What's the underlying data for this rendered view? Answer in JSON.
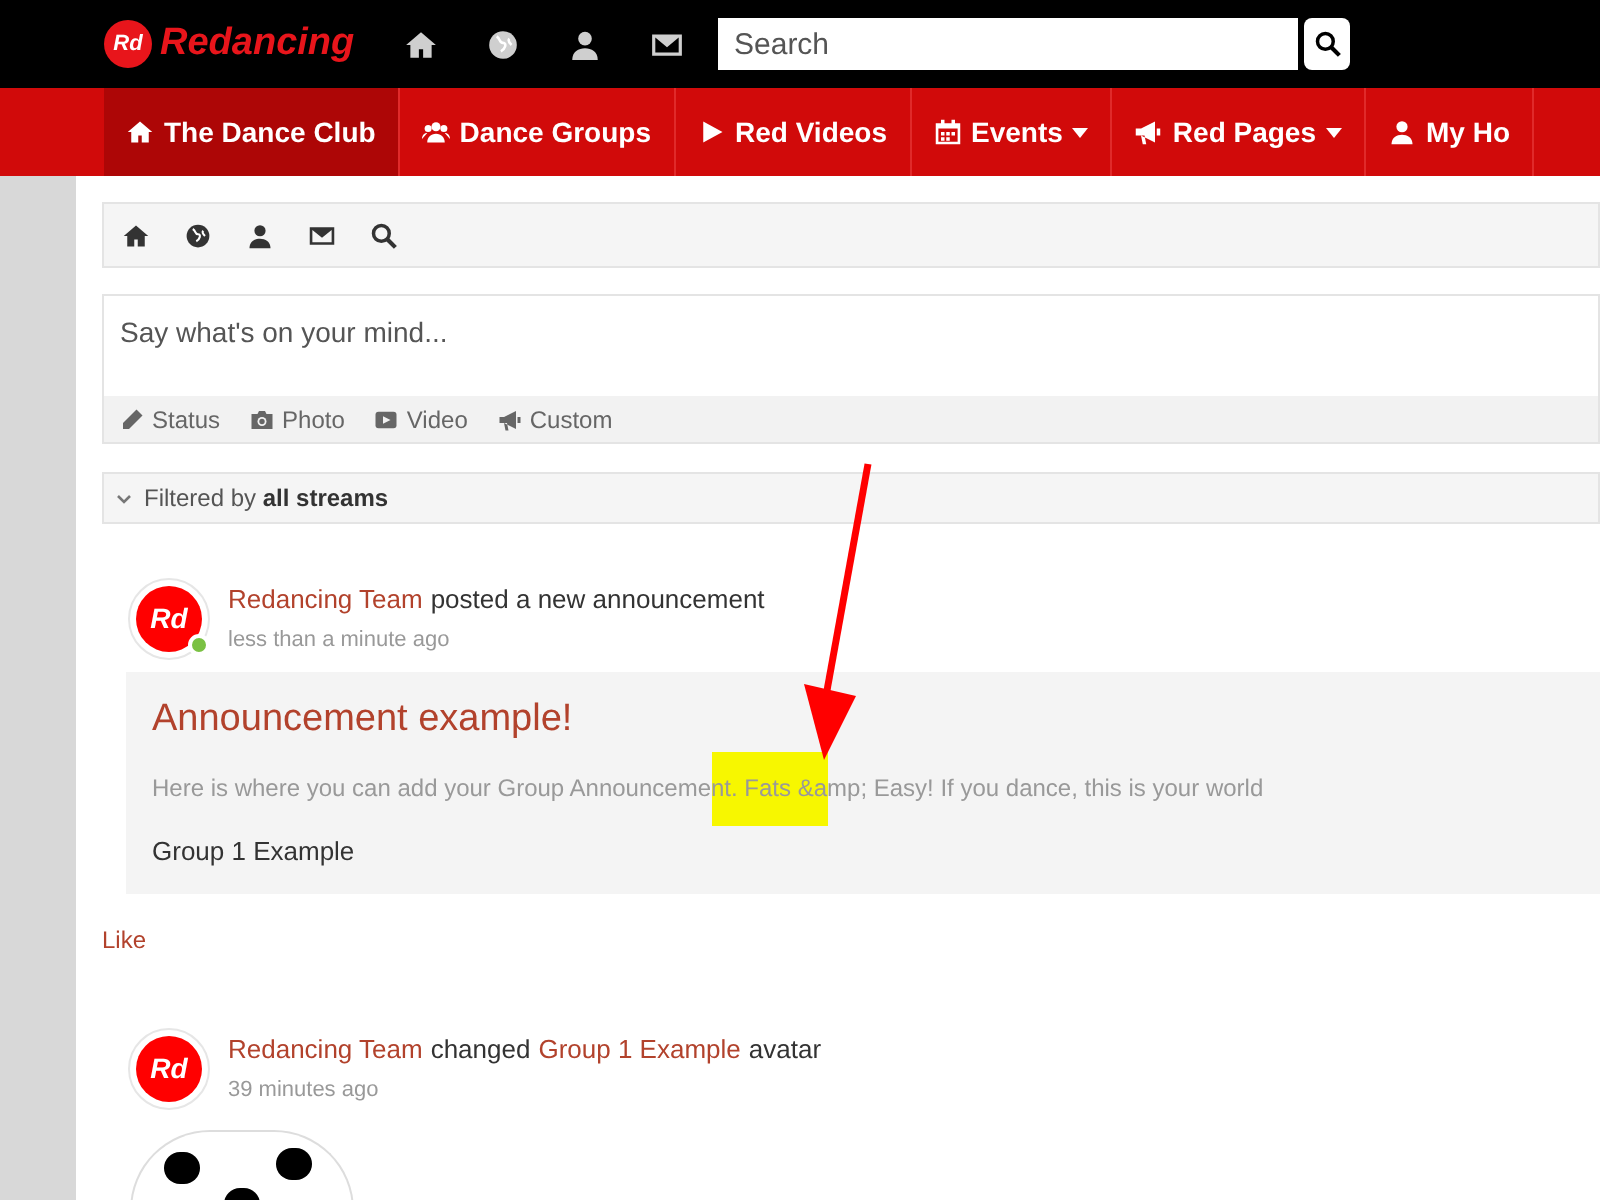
{
  "header": {
    "logo_badge": "Rd",
    "logo": "Redancing",
    "search": {
      "placeholder": "Search"
    }
  },
  "nav": [
    {
      "label": "The Dance Club",
      "selected": true,
      "dropdown": false
    },
    {
      "label": "Dance Groups",
      "selected": false,
      "dropdown": false
    },
    {
      "label": "Red Videos",
      "selected": false,
      "dropdown": false
    },
    {
      "label": "Events",
      "selected": false,
      "dropdown": true
    },
    {
      "label": "Red Pages",
      "selected": false,
      "dropdown": true
    },
    {
      "label": "My Ho",
      "selected": false,
      "dropdown": false
    }
  ],
  "composer": {
    "placeholder": "Say what's on your mind...",
    "actions": [
      {
        "label": "Status"
      },
      {
        "label": "Photo"
      },
      {
        "label": "Video"
      },
      {
        "label": "Custom"
      }
    ]
  },
  "filter": {
    "text": "Filtered by **all streams**"
  },
  "posts": [
    {
      "avatar": "Rd",
      "online": true,
      "parts": [
        {
          "kind": "link",
          "text": "Redancing Team"
        },
        {
          "kind": "text",
          "text": "posted a new announcement"
        }
      ],
      "time": "less than a minute ago",
      "announcement": {
        "title": "Announcement example!",
        "body": "Here is where you can add your Group Announcement. Fats &amp; Easy! If you dance, this is your world",
        "group": "Group 1 Example"
      },
      "like": "Like"
    },
    {
      "avatar": "Rd",
      "online": false,
      "parts": [
        {
          "kind": "link",
          "text": "Redancing Team"
        },
        {
          "kind": "text",
          "text": "changed"
        },
        {
          "kind": "link",
          "text": "Group 1 Example"
        },
        {
          "kind": "text",
          "text": "avatar"
        }
      ],
      "time": "39 minutes ago"
    }
  ]
}
